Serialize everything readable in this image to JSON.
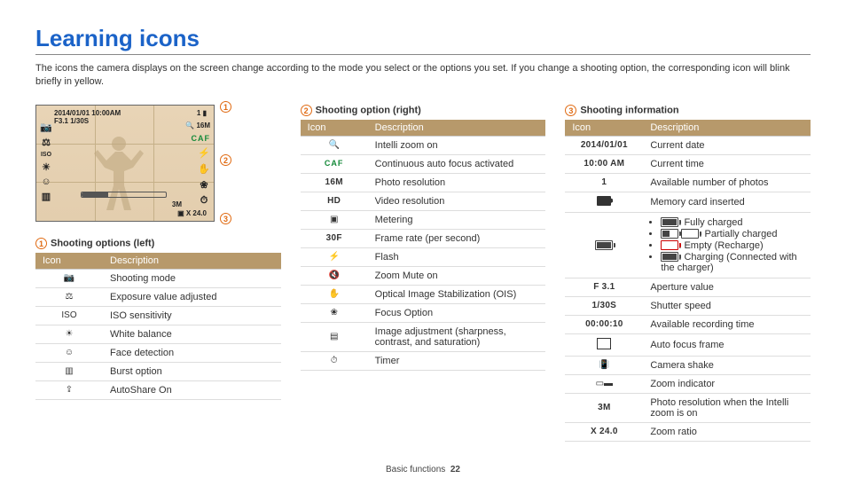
{
  "title": "Learning icons",
  "intro": "The icons the camera displays on the screen change according to the mode you select or the options you set. If you change a shooting option, the corresponding icon will blink briefly in yellow.",
  "preview": {
    "topline": "2014/01/01  10:00AM",
    "line2": "F3.1  1/30S",
    "right_zoom": "16M",
    "right_caf": "CAF",
    "bottom_res": "3M",
    "bottom_zoom": "X 24.0"
  },
  "callouts": {
    "c1": "1",
    "c2": "2",
    "c3": "3"
  },
  "footer": {
    "section": "Basic functions",
    "page": "22"
  },
  "tab_left": {
    "heading": "Shooting options (left)",
    "head_icon": "Icon",
    "head_desc": "Description",
    "rows": [
      {
        "icon": "📷",
        "desc": "Shooting mode"
      },
      {
        "icon": "⚖",
        "desc": "Exposure value adjusted"
      },
      {
        "icon": "ISO",
        "desc": "ISO sensitivity"
      },
      {
        "icon": "☀",
        "desc": "White balance"
      },
      {
        "icon": "☺",
        "desc": "Face detection"
      },
      {
        "icon": "▥",
        "desc": "Burst option"
      },
      {
        "icon": "⇪",
        "desc": "AutoShare On"
      }
    ]
  },
  "tab_right": {
    "heading": "Shooting option (right)",
    "head_icon": "Icon",
    "head_desc": "Description",
    "rows_a": [
      {
        "icon": "🔍",
        "desc": "Intelli zoom on"
      }
    ],
    "caf_row": {
      "icon": "CAF",
      "desc": "Continuous auto focus activated"
    },
    "rows_b": [
      {
        "icon": "16M",
        "cls": "lcd",
        "desc": "Photo resolution"
      },
      {
        "icon": "HD",
        "cls": "lcd",
        "desc": "Video resolution"
      },
      {
        "icon": "▣",
        "desc": "Metering"
      },
      {
        "icon": "30F",
        "cls": "lcd",
        "desc": "Frame rate (per second)"
      },
      {
        "icon": "⚡",
        "desc": "Flash"
      },
      {
        "icon": "🔇",
        "desc": "Zoom Mute on"
      },
      {
        "icon": "✋",
        "desc": "Optical Image Stabilization (OIS)"
      },
      {
        "icon": "❀",
        "desc": "Focus Option"
      },
      {
        "icon": "▤",
        "desc": "Image adjustment (sharpness, contrast, and saturation)"
      },
      {
        "icon": "⏱",
        "desc": "Timer"
      }
    ]
  },
  "tab_info": {
    "heading": "Shooting information",
    "head_icon": "Icon",
    "head_desc": "Description",
    "rows_a": [
      {
        "icon": "2014/01/01",
        "cls": "lcd",
        "desc": "Current date"
      },
      {
        "icon": "10:00 AM",
        "cls": "lcd",
        "desc": "Current time"
      },
      {
        "icon": "1",
        "cls": "lcd",
        "desc": "Available number of photos"
      }
    ],
    "card_row": {
      "desc": "Memory card inserted"
    },
    "battery": {
      "full": ": Fully charged",
      "partial": ": Partially charged",
      "empty": ": Empty (Recharge)",
      "charge": ": Charging (Connected with the charger)"
    },
    "rows_b": [
      {
        "icon": "F 3.1",
        "cls": "lcd",
        "desc": "Aperture value"
      },
      {
        "icon": "1/30S",
        "cls": "lcd",
        "desc": "Shutter speed"
      },
      {
        "icon": "00:00:10",
        "cls": "lcd",
        "desc": "Available recording time"
      }
    ],
    "frame_row": {
      "desc": "Auto focus frame"
    },
    "rows_c": [
      {
        "icon": "📳",
        "desc": "Camera shake"
      },
      {
        "icon": "▭▬",
        "desc": "Zoom indicator"
      },
      {
        "icon": "3M",
        "cls": "lcd",
        "desc": "Photo resolution when the Intelli zoom is on"
      },
      {
        "icon": "X 24.0",
        "cls": "lcd",
        "desc": "Zoom ratio"
      }
    ]
  }
}
